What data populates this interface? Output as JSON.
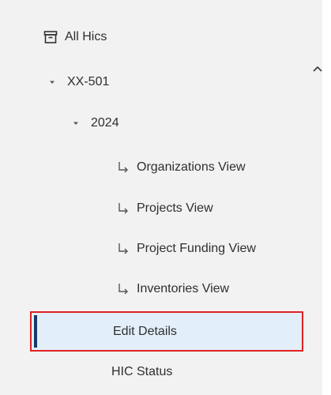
{
  "nav": {
    "all_hics": "All Hics",
    "hic_code": "XX-501",
    "year": "2024",
    "views": [
      "Organizations View",
      "Projects View",
      "Project Funding View",
      "Inventories View"
    ],
    "edit_details": "Edit Details",
    "hic_status": "HIC Status"
  },
  "colors": {
    "panel_bg": "#f2f2f2",
    "selected_bg": "#e3eefb",
    "selected_indicator": "#163a6b",
    "highlight_border": "#e02222",
    "text": "#2f2f2f"
  },
  "icons": {
    "all_hics": "archive-icon",
    "expand": "caret-down-icon",
    "view_items": "subdirectory-arrow-icon",
    "collapse": "chevron-up-icon"
  }
}
